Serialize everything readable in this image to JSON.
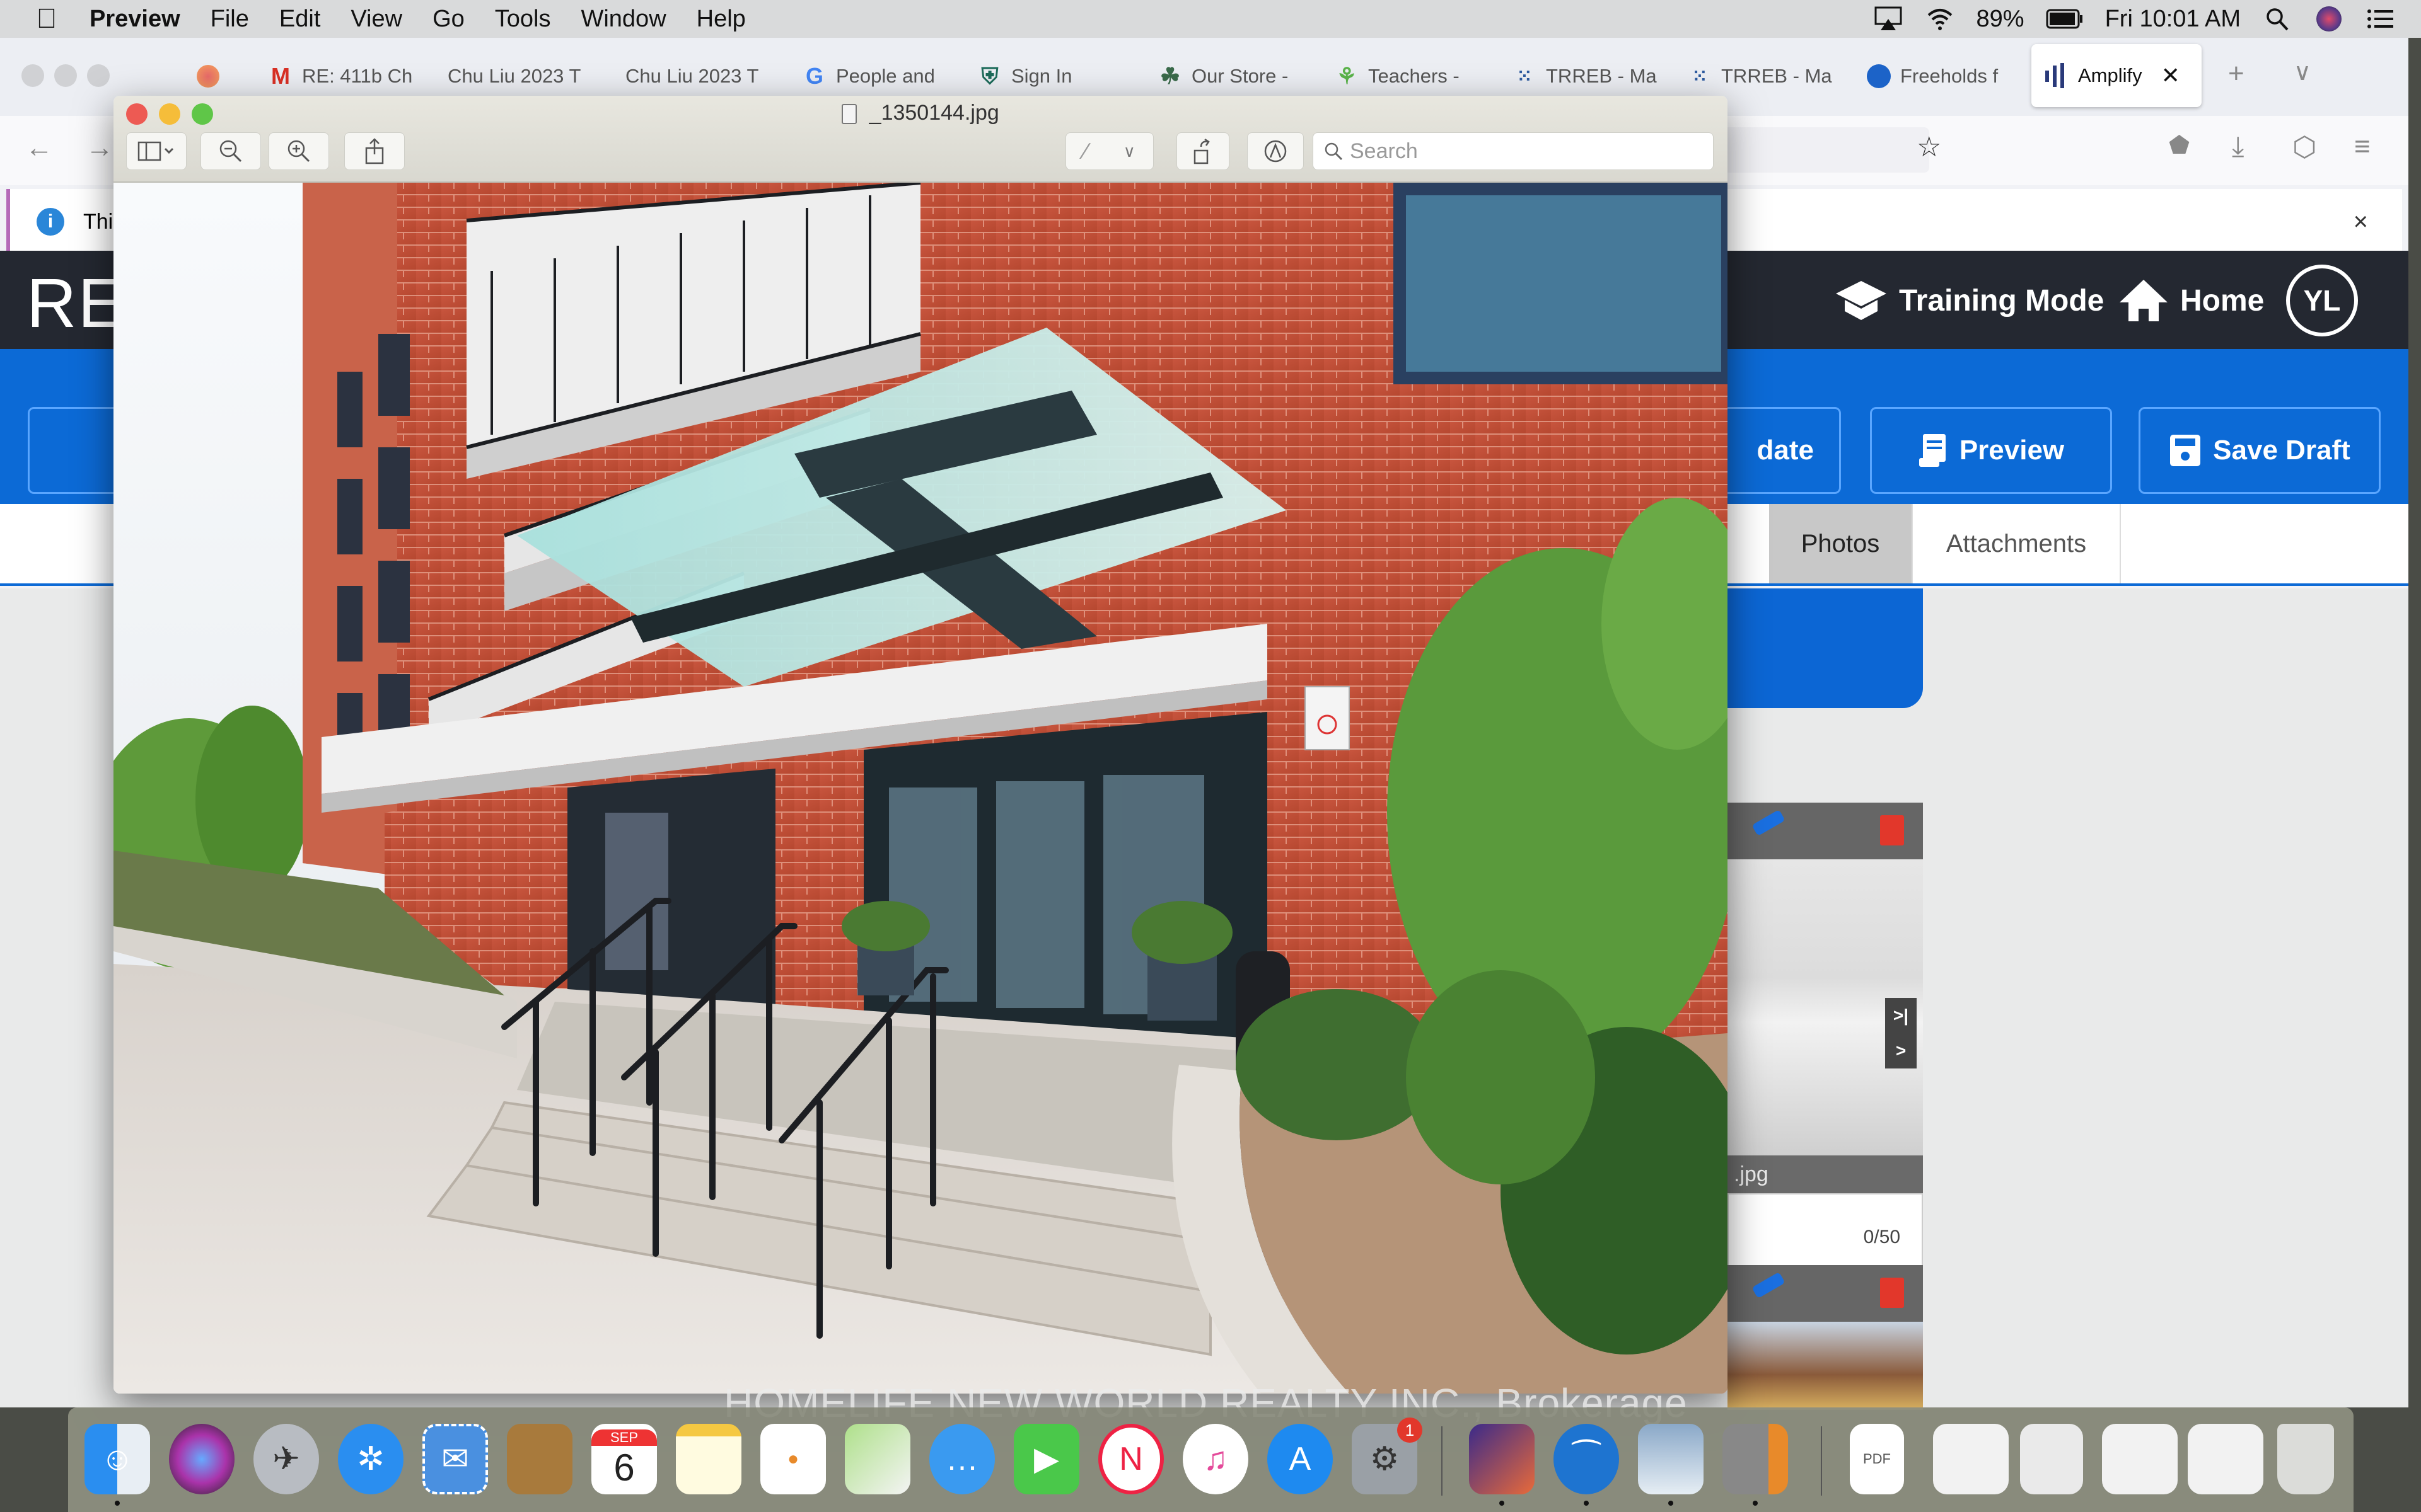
{
  "menubar": {
    "app_name": "Preview",
    "items": [
      "File",
      "Edit",
      "View",
      "Go",
      "Tools",
      "Window",
      "Help"
    ],
    "battery": "89%",
    "clock": "Fri 10:01 AM"
  },
  "browser": {
    "tabs": [
      {
        "label": "RE: 411b Ch",
        "icon": "gmail-icon"
      },
      {
        "label": "Chu Liu 2023 T",
        "icon": "none"
      },
      {
        "label": "Chu Liu 2023 T",
        "icon": "none"
      },
      {
        "label": "People and",
        "icon": "google-icon"
      },
      {
        "label": "Sign In",
        "icon": "shield-plus-icon"
      },
      {
        "label": "Our Store -",
        "icon": "leaf-icon"
      },
      {
        "label": "Teachers -",
        "icon": "tree-icon"
      },
      {
        "label": "TRREB - Ma",
        "icon": "dots-icon"
      },
      {
        "label": "TRREB - Ma",
        "icon": "dots-icon"
      },
      {
        "label": "Freeholds f",
        "icon": "house-circle-icon"
      },
      {
        "label": "Amplify",
        "icon": "bars-icon",
        "active": true
      }
    ],
    "notification": "This",
    "notification_close": "×"
  },
  "app": {
    "logo": "RE",
    "header_links": [
      {
        "label": "Training Mode",
        "icon": "graduation-cap-icon"
      },
      {
        "label": "Home",
        "icon": "home-icon"
      }
    ],
    "avatar_initials": "YL",
    "actions": [
      {
        "label": "date",
        "icon": "none"
      },
      {
        "label": "Preview",
        "icon": "document-icon"
      },
      {
        "label": "Save Draft",
        "icon": "floppy-icon"
      }
    ],
    "tabs": [
      {
        "label": "Photos",
        "active": true
      },
      {
        "label": "Attachments",
        "active": false
      }
    ],
    "photos": [
      {
        "caption": ".jpg",
        "caption_counter": "0/50"
      },
      {
        "caption": "",
        "caption_counter": ""
      }
    ]
  },
  "preview_window": {
    "filename": "_1350144.jpg",
    "search_placeholder": "Search"
  },
  "dock": {
    "apps": [
      "Finder",
      "Siri",
      "Launchpad",
      "Safari",
      "Mail",
      "Contacts",
      "Calendar",
      "Notes",
      "Reminders",
      "Maps",
      "Messages",
      "FaceTime",
      "News",
      "Music",
      "App Store",
      "System Preferences",
      "Firefox",
      "OpenOffice",
      "Preview",
      "Calculator"
    ],
    "calendar_month": "SEP",
    "calendar_day": "6",
    "system_prefs_badge": "1"
  },
  "watermark": "HOMELIFE NEW WORLD REALTY INC., Brokerage"
}
